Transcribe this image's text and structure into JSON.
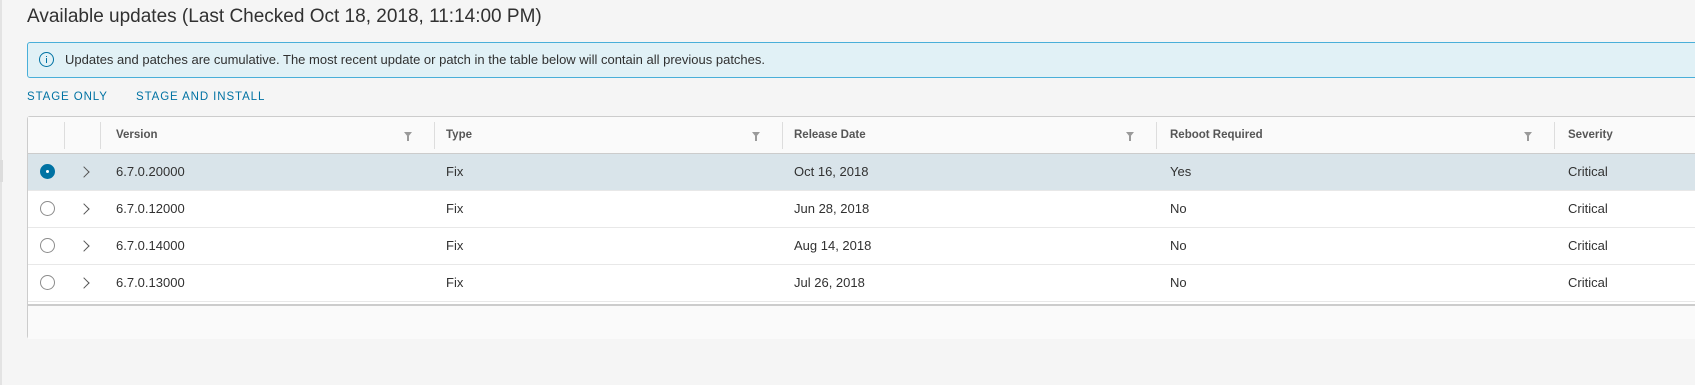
{
  "title": "Available updates (Last Checked Oct 18, 2018, 11:14:00 PM)",
  "alert": {
    "icon": "info-circle-icon",
    "text": "Updates and patches are cumulative. The most recent update or patch in the table below will contain all previous patches."
  },
  "actions": {
    "stage_only": "STAGE ONLY",
    "stage_and_install": "STAGE AND INSTALL"
  },
  "columns": {
    "version": "Version",
    "type": "Type",
    "release_date": "Release Date",
    "reboot_required": "Reboot Required",
    "severity": "Severity"
  },
  "rows": [
    {
      "version": "6.7.0.20000",
      "type": "Fix",
      "release_date": "Oct 16, 2018",
      "reboot": "Yes",
      "severity": "Critical",
      "selected": true
    },
    {
      "version": "6.7.0.12000",
      "type": "Fix",
      "release_date": "Jun 28, 2018",
      "reboot": "No",
      "severity": "Critical",
      "selected": false
    },
    {
      "version": "6.7.0.14000",
      "type": "Fix",
      "release_date": "Aug 14, 2018",
      "reboot": "No",
      "severity": "Critical",
      "selected": false
    },
    {
      "version": "6.7.0.13000",
      "type": "Fix",
      "release_date": "Jul 26, 2018",
      "reboot": "No",
      "severity": "Critical",
      "selected": false
    }
  ],
  "colors": {
    "accent": "#0072a3",
    "alert_bg": "#e1f1f6",
    "alert_border": "#49afd9",
    "selected_row": "#d9e4ea"
  }
}
